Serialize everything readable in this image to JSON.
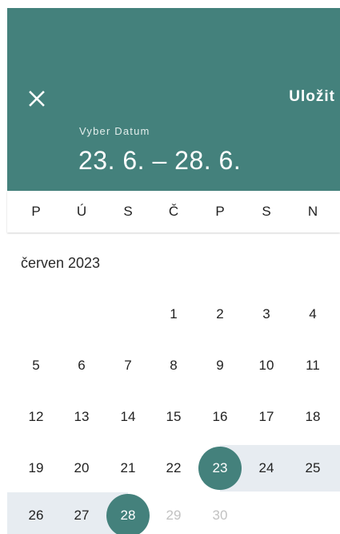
{
  "header": {
    "close_icon": "close-icon",
    "save_label": "Uložit",
    "label": "Vyber Datum",
    "range": "23. 6. – 28. 6."
  },
  "weekdays": [
    "P",
    "Ú",
    "S",
    "Č",
    "P",
    "S",
    "N"
  ],
  "month": {
    "title": "červen 2023",
    "weeks": [
      [
        null,
        null,
        null,
        "1",
        "2",
        "3",
        "4"
      ],
      [
        "5",
        "6",
        "7",
        "8",
        "9",
        "10",
        "11"
      ],
      [
        "12",
        "13",
        "14",
        "15",
        "16",
        "17",
        "18"
      ],
      [
        "19",
        "20",
        "21",
        "22",
        "23",
        "24",
        "25"
      ],
      [
        "26",
        "27",
        "28",
        "29",
        "30",
        null,
        null
      ]
    ],
    "range_start": "23",
    "range_end": "28",
    "disabled_days": [
      "29",
      "30"
    ]
  },
  "colors": {
    "accent": "#44817c",
    "range_band": "#e7ecf1",
    "disabled_text": "#c2c2c2"
  }
}
